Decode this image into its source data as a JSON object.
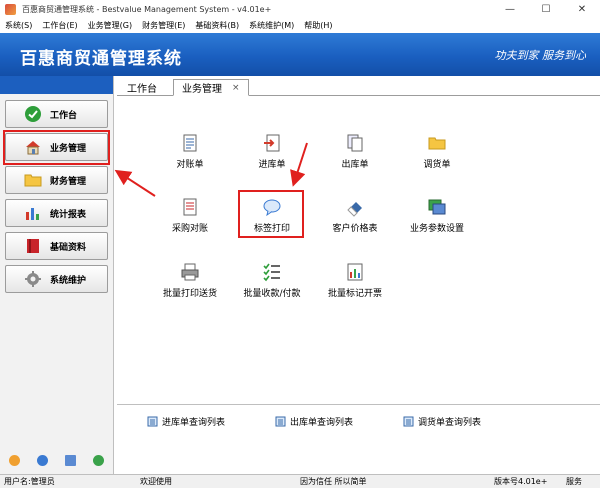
{
  "window": {
    "title": "百惠商贸通管理系统 - Bestvalue Management System - v4.01e+",
    "minimize": "—",
    "maximize": "☐",
    "close": "✕"
  },
  "menu": [
    "系统(S)",
    "工作台(E)",
    "业务管理(G)",
    "财务管理(E)",
    "基础资料(B)",
    "系统维护(M)",
    "帮助(H)"
  ],
  "banner": {
    "title": "百惠商贸通管理系统",
    "slogan": "功夫到家 服务到心"
  },
  "sidebar": {
    "items": [
      {
        "label": "工作台",
        "icon": "check-circle-icon"
      },
      {
        "label": "业务管理",
        "icon": "house-icon"
      },
      {
        "label": "财务管理",
        "icon": "folder-icon"
      },
      {
        "label": "统计报表",
        "icon": "bar-chart-icon"
      },
      {
        "label": "基础资料",
        "icon": "book-icon"
      },
      {
        "label": "系统维护",
        "icon": "gear-icon"
      }
    ]
  },
  "tabs": [
    {
      "label": "工作台"
    },
    {
      "label": "业务管理",
      "close": "×"
    }
  ],
  "workspace": {
    "items": [
      {
        "label": "对账单",
        "icon": "document-list-icon"
      },
      {
        "label": "进库单",
        "icon": "import-document-icon"
      },
      {
        "label": "出库单",
        "icon": "copy-document-icon"
      },
      {
        "label": "调货单",
        "icon": "folder-icon"
      },
      {
        "label": "采购对账",
        "icon": "document-list-icon"
      },
      {
        "label": "标签打印",
        "icon": "speech-bubble-icon"
      },
      {
        "label": "客户价格表",
        "icon": "eraser-icon"
      },
      {
        "label": "业务参数设置",
        "icon": "windows-icon"
      },
      {
        "label": "批量打印送货",
        "icon": "printer-icon"
      },
      {
        "label": "批量收款/付款",
        "icon": "checklist-icon"
      },
      {
        "label": "批量标记开票",
        "icon": "chart-document-icon"
      }
    ]
  },
  "quicklinks": [
    {
      "label": "进库单查询列表"
    },
    {
      "label": "出库单查询列表"
    },
    {
      "label": "调货单查询列表"
    }
  ],
  "status": {
    "user": "用户名:管理员",
    "welcome": "欢迎使用",
    "motto": "因为信任 所以简单",
    "version": "版本号4.01e+",
    "service": "服务"
  },
  "colors": {
    "banner": "#1a5fc0",
    "highlight": "#e0201e"
  }
}
